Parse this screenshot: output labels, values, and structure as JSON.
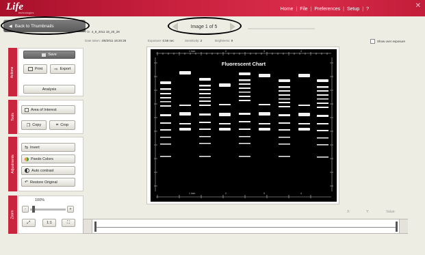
{
  "app": {
    "logo": "Life",
    "logo_sub": "technologies"
  },
  "nav": [
    "Home",
    "File",
    "Preferences",
    "Setup",
    "?"
  ],
  "back_button": "Back to Thumbnails",
  "image_nav": {
    "label": "Image 1 of 5"
  },
  "meta": {
    "file_label": "File:",
    "file_value": "4_8_2011 18_20_28",
    "date_label": "Date taken:",
    "date_value": "4/8/2011 18:20:28",
    "exposure_label": "Exposure:",
    "exposure_value": "0.56 sec",
    "sensitivity_label": "Sensitivity:",
    "sensitivity_value": "2",
    "brightness_label": "Brightness:",
    "brightness_value": "9"
  },
  "show_over_exposure": "Show over exposure",
  "sections": {
    "actions": "Actions",
    "tools": "Tools",
    "adjustments": "Adjustments",
    "zoom": "Zoom"
  },
  "actions": {
    "save": "Save",
    "print": "Print",
    "export": "Export",
    "analysis": "Analysis"
  },
  "tools": {
    "aoi": "Area of Interest",
    "copy": "Copy",
    "crop": "Crop"
  },
  "adjustments": {
    "invert": "Invert",
    "pseudo": "Psedo Colors",
    "auto": "Auto contrast",
    "restore": "Restore Original"
  },
  "zoom": {
    "value": "100%",
    "minus": "-",
    "plus": "+",
    "one_to_one": "1:1"
  },
  "image": {
    "title": "Fluorescent Chart",
    "ruler_top": [
      "1 inch",
      "2",
      "3",
      "4"
    ],
    "ruler_bottom": [
      "1 inch",
      "2",
      "3",
      "4"
    ]
  },
  "readout": {
    "x": "X:",
    "y": "Y:",
    "value": "Value:"
  }
}
